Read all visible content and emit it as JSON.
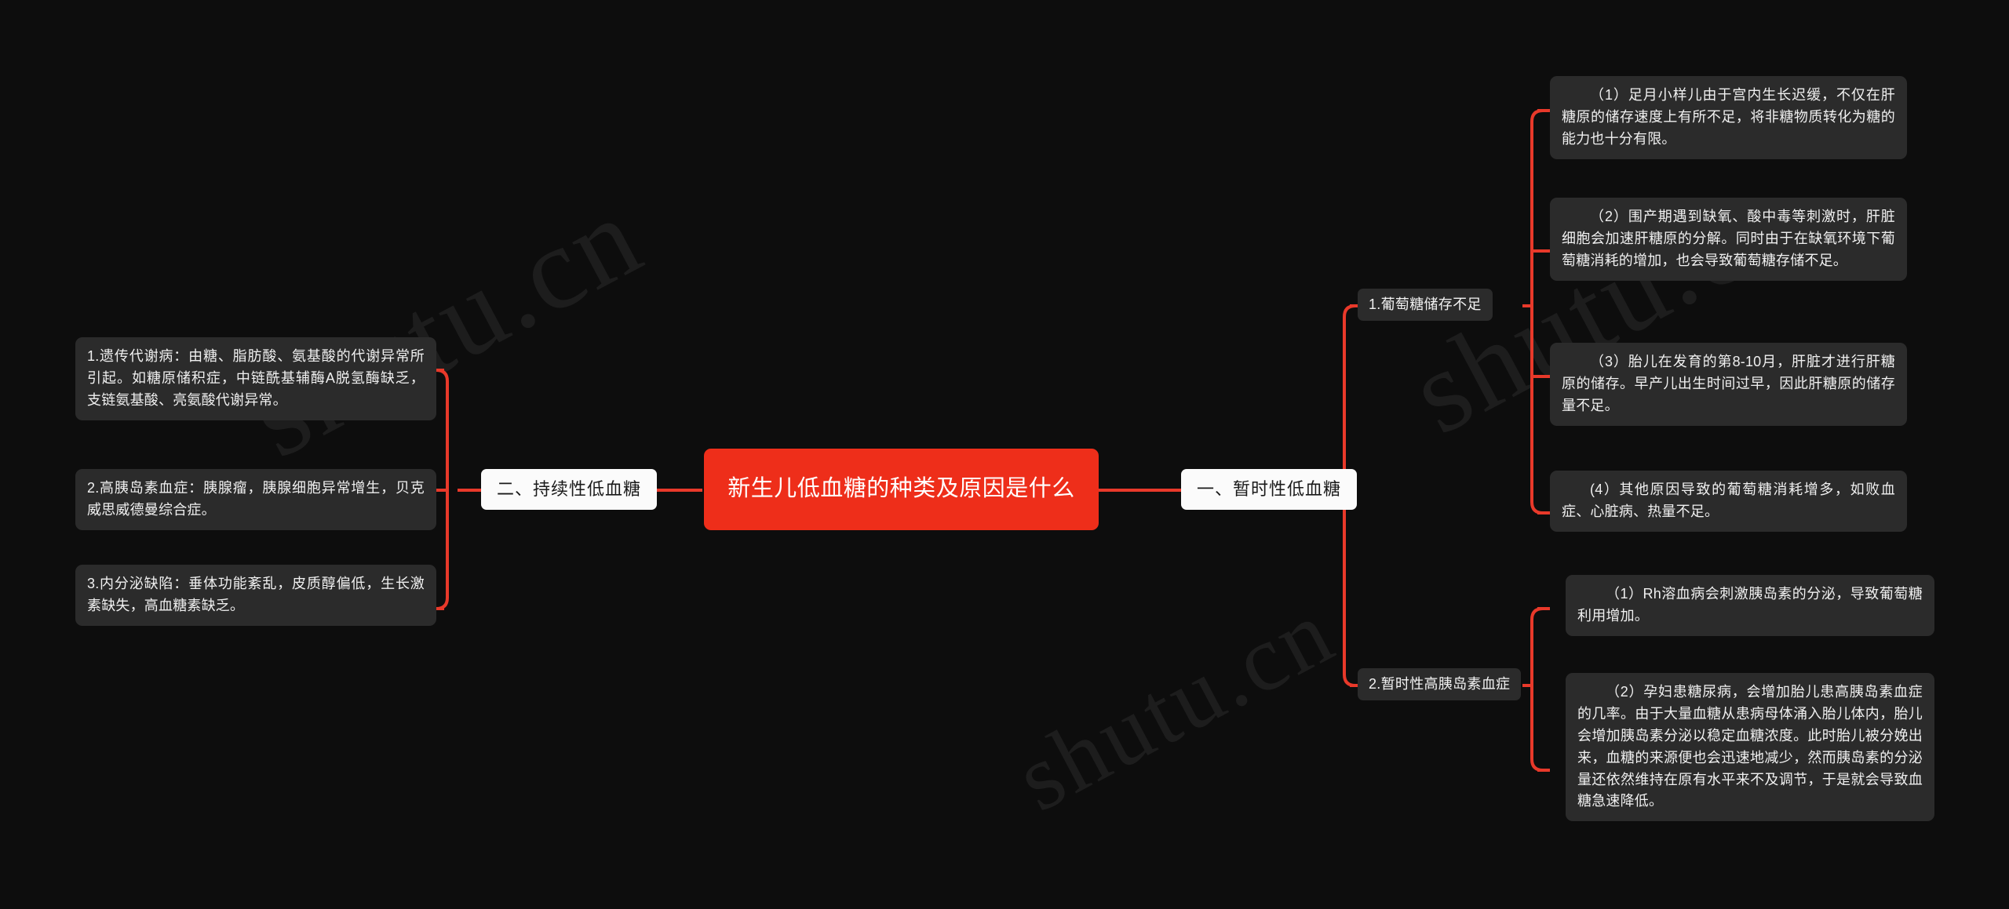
{
  "diagram": {
    "type": "mindmap",
    "orientation": "horizontal-bidirectional",
    "colors": {
      "background": "#0d0d0d",
      "accent_red": "#ee2e1a",
      "connector_red": "#e8392a",
      "node_dark": "#2b2b2b",
      "node_white": "#fbfbfb",
      "text_light": "#f0f0f0",
      "text_dark": "#1a1a1a",
      "watermark": "#1d1d1d"
    },
    "watermark_text": "shutu.cn"
  },
  "root": {
    "label": "新生儿低血糖的种类及原因是什么"
  },
  "left_branch": {
    "label": "二、持续性低血糖",
    "children": [
      {
        "label": "1.遗传代谢病：由糖、脂肪酸、氨基酸的代谢异常所引起。如糖原储积症，中链酰基辅酶A脱氢酶缺乏，支链氨基酸、亮氨酸代谢异常。"
      },
      {
        "label": "2.高胰岛素血症：胰腺瘤，胰腺细胞异常增生，贝克威思威德曼综合症。"
      },
      {
        "label": "3.内分泌缺陷：垂体功能紊乱，皮质醇偏低，生长激素缺失，高血糖素缺乏。"
      }
    ]
  },
  "right_branch": {
    "label": "一、暂时性低血糖",
    "groups": [
      {
        "label": "1.葡萄糖储存不足",
        "items": [
          {
            "label": "（1）足月小样儿由于宫内生长迟缓，不仅在肝糖原的储存速度上有所不足，将非糖物质转化为糖的能力也十分有限。"
          },
          {
            "label": "（2）围产期遇到缺氧、酸中毒等刺激时，肝脏细胞会加速肝糖原的分解。同时由于在缺氧环境下葡萄糖消耗的增加，也会导致葡萄糖存储不足。"
          },
          {
            "label": "（3）胎儿在发育的第8-10月，肝脏才进行肝糖原的储存。早产儿出生时间过早，因此肝糖原的储存量不足。"
          },
          {
            "label": "(4）其他原因导致的葡萄糖消耗增多，如败血症、心脏病、热量不足。"
          }
        ]
      },
      {
        "label": "2.暂时性高胰岛素血症",
        "items": [
          {
            "label": "（1）Rh溶血病会刺激胰岛素的分泌，导致葡萄糖利用增加。"
          },
          {
            "label": "（2）孕妇患糖尿病，会增加胎儿患高胰岛素血症的几率。由于大量血糖从患病母体涌入胎儿体内，胎儿会增加胰岛素分泌以稳定血糖浓度。此时胎儿被分娩出来，血糖的来源便也会迅速地减少，然而胰岛素的分泌量还依然维持在原有水平来不及调节，于是就会导致血糖急速降低。"
          }
        ]
      }
    ]
  }
}
